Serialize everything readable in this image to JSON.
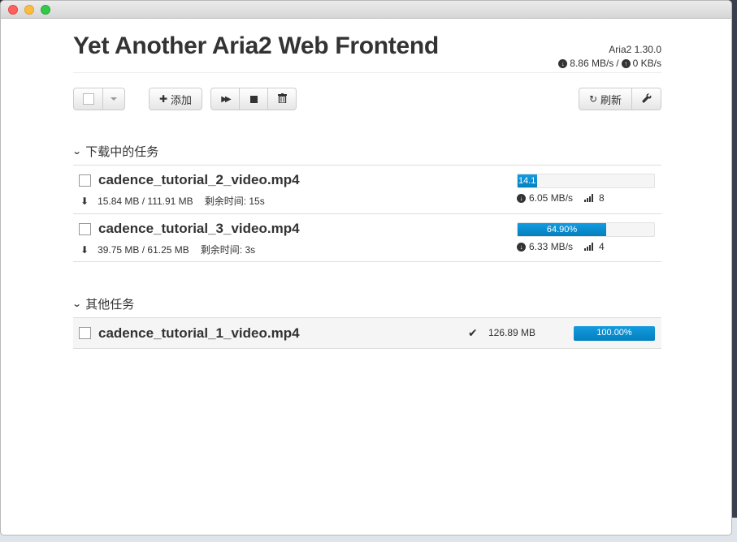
{
  "app": {
    "title": "Yet Another Aria2 Web Frontend",
    "version": "Aria2 1.30.0",
    "download_speed": "8.86 MB/s",
    "upload_speed": "0 KB/s",
    "speed_separator": "/"
  },
  "toolbar": {
    "add_label": "添加",
    "refresh_label": "刷新"
  },
  "sections": {
    "active_title": "下载中的任务",
    "other_title": "其他任务"
  },
  "active_tasks": [
    {
      "name": "cadence_tutorial_2_video.mp4",
      "size": "15.84 MB / 111.91 MB",
      "remaining": "剩余时间: 15s",
      "progress": 14.15,
      "progress_label": "14.1",
      "speed": "6.05 MB/s",
      "connections": "8"
    },
    {
      "name": "cadence_tutorial_3_video.mp4",
      "size": "39.75 MB / 61.25 MB",
      "remaining": "剩余时间: 3s",
      "progress": 64.9,
      "progress_label": "64.90%",
      "speed": "6.33 MB/s",
      "connections": "4"
    }
  ],
  "other_tasks": [
    {
      "name": "cadence_tutorial_1_video.mp4",
      "size": "126.89 MB",
      "progress": 100,
      "progress_label": "100.00%"
    }
  ],
  "colors": {
    "progress": "#0f8fcf",
    "title": "#333333"
  }
}
